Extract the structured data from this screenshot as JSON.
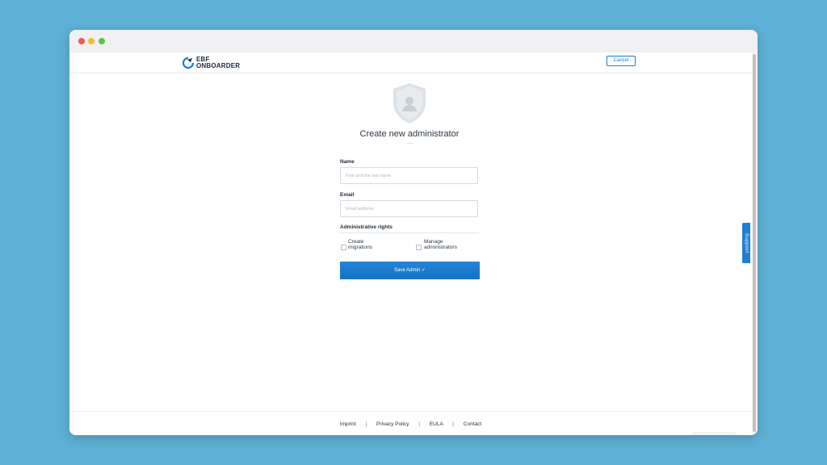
{
  "window": {
    "controls": [
      "close",
      "minimize",
      "maximize"
    ]
  },
  "header": {
    "logo_line1": "EBF",
    "logo_line2": "ONBOARDER",
    "cancel_label": "Cancel"
  },
  "support": {
    "label": "Support"
  },
  "form": {
    "title": "Create new administrator",
    "name_label": "Name",
    "name_placeholder": "First and the last name",
    "name_value": "",
    "email_label": "Email",
    "email_placeholder": "Email address",
    "email_value": "",
    "rights_label": "Administrative rights",
    "rights": [
      {
        "line1": "Create",
        "line2": "migrations",
        "checked": false
      },
      {
        "line1": "Manage",
        "line2": "administrators",
        "checked": false
      }
    ],
    "save_label": "Save Admin ✓"
  },
  "footer": {
    "links": [
      "Imprint",
      "Privacy Policy",
      "EULA",
      "Contact"
    ]
  },
  "colors": {
    "background": "#5eb0d6",
    "accent": "#1b7fcf",
    "button": "#1a7ad0",
    "text": "#2c3744"
  },
  "icons": [
    "shield-user-icon",
    "logo-mark-icon",
    "check-icon"
  ]
}
